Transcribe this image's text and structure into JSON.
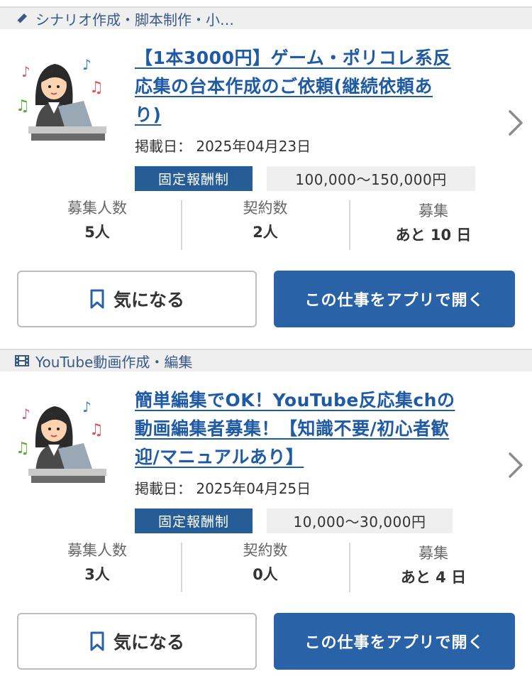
{
  "colors": {
    "accent": "#2a62a8",
    "link": "#1f5aa5",
    "badge": "#275d97",
    "category_bar": "#efefef"
  },
  "jobs": [
    {
      "category": {
        "icon": "pencil-icon",
        "label": "シナリオ作成・脚本制作・小…"
      },
      "thumbnail": "woman-at-computer-illustration",
      "title": "【1本3000円】ゲーム・ポリコレ系反応集の台本作成のご依頼(継続依頼あり)",
      "title_lines": [
        "【1本3000円】ゲーム・ポリコレ系反",
        "応集の台本作成のご依頼(継続依頼あ",
        "り)"
      ],
      "posted": "掲載日： 2025年04月23日",
      "pay_type": "固定報酬制",
      "amount": "100,000〜150,000円",
      "stats": {
        "recruit_label": "募集人数",
        "recruit_value": "5人",
        "contract_label": "契約数",
        "contract_value": "2人",
        "deadline_label": "募集",
        "deadline_value": "あと 10 日"
      },
      "fav_label": "気になる",
      "app_label": "この仕事をアプリで開く"
    },
    {
      "category": {
        "icon": "film-icon",
        "label": "YouTube動画作成・編集"
      },
      "thumbnail": "woman-at-computer-illustration",
      "title": "簡単編集でOK！YouTube反応集chの動画編集者募集！【知識不要/初心者歓迎/マニュアルあり】",
      "title_lines": [
        "簡単編集でOK！YouTube反応集chの",
        "動画編集者募集！【知識不要/初心者歓",
        "迎/マニュアルあり】"
      ],
      "posted": "掲載日： 2025年04月25日",
      "pay_type": "固定報酬制",
      "amount": "10,000〜30,000円",
      "stats": {
        "recruit_label": "募集人数",
        "recruit_value": "3人",
        "contract_label": "契約数",
        "contract_value": "0人",
        "deadline_label": "募集",
        "deadline_value": "あと 4 日"
      },
      "fav_label": "気になる",
      "app_label": "この仕事をアプリで開く"
    }
  ]
}
